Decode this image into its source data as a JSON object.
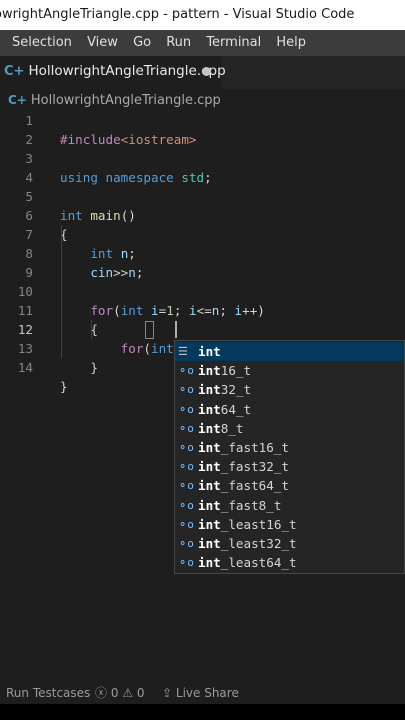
{
  "window": {
    "title": "owrightAngleTriangle.cpp - pattern - Visual Studio Code"
  },
  "menu": [
    "Selection",
    "View",
    "Go",
    "Run",
    "Terminal",
    "Help"
  ],
  "tab": {
    "icon": "C+",
    "label": "HollowrightAngleTriangle.cpp"
  },
  "breadcrumb": {
    "icon": "C+",
    "label": "HollowrightAngleTriangle.cpp"
  },
  "editor": {
    "line_numbers": [
      "1",
      "2",
      "3",
      "4",
      "5",
      "6",
      "7",
      "8",
      "9",
      "10",
      "11",
      "12",
      "13",
      "14"
    ],
    "current_line": "12"
  },
  "suggest": {
    "typed": "int",
    "items": [
      {
        "icon": "keyword",
        "label": "int",
        "rest": ""
      },
      {
        "icon": "reference",
        "label": "int",
        "rest": "16_t"
      },
      {
        "icon": "reference",
        "label": "int",
        "rest": "32_t"
      },
      {
        "icon": "reference",
        "label": "int",
        "rest": "64_t"
      },
      {
        "icon": "reference",
        "label": "int",
        "rest": "8_t"
      },
      {
        "icon": "reference",
        "label": "int",
        "rest": "_fast16_t"
      },
      {
        "icon": "reference",
        "label": "int",
        "rest": "_fast32_t"
      },
      {
        "icon": "reference",
        "label": "int",
        "rest": "_fast64_t"
      },
      {
        "icon": "reference",
        "label": "int",
        "rest": "_fast8_t"
      },
      {
        "icon": "reference",
        "label": "int",
        "rest": "_least16_t"
      },
      {
        "icon": "reference",
        "label": "int",
        "rest": "_least32_t"
      },
      {
        "icon": "reference",
        "label": "int",
        "rest": "_least64_t"
      }
    ]
  },
  "status": {
    "run_testcases": "Run Testcases",
    "errors": "0",
    "warnings": "0",
    "live_share": "Live Share"
  },
  "colors": {
    "keyword": "#569cd6",
    "control": "#c586c0",
    "string": "#ce9178",
    "function": "#dcdcaa",
    "number": "#b5cea8",
    "variable": "#9cdcfe"
  }
}
